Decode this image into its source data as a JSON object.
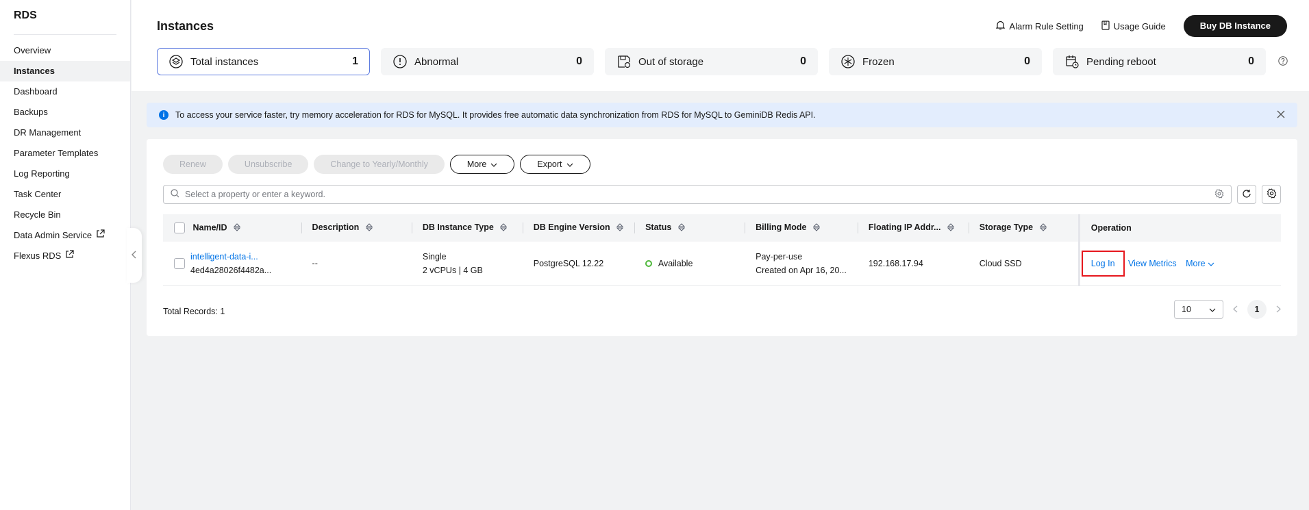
{
  "sidebar": {
    "title": "RDS",
    "items": [
      {
        "label": "Overview"
      },
      {
        "label": "Instances"
      },
      {
        "label": "Dashboard"
      },
      {
        "label": "Backups"
      },
      {
        "label": "DR Management"
      },
      {
        "label": "Parameter Templates"
      },
      {
        "label": "Log Reporting"
      },
      {
        "label": "Task Center"
      },
      {
        "label": "Recycle Bin"
      },
      {
        "label": "Data Admin Service"
      },
      {
        "label": "Flexus RDS"
      }
    ]
  },
  "header": {
    "title": "Instances",
    "alarm_label": "Alarm Rule Setting",
    "guide_label": "Usage Guide",
    "buy_label": "Buy DB Instance"
  },
  "stats": [
    {
      "label": "Total instances",
      "count": "1"
    },
    {
      "label": "Abnormal",
      "count": "0"
    },
    {
      "label": "Out of storage",
      "count": "0"
    },
    {
      "label": "Frozen",
      "count": "0"
    },
    {
      "label": "Pending reboot",
      "count": "0"
    }
  ],
  "notice": {
    "text": "To access your service faster, try memory acceleration for RDS for MySQL. It provides free automatic data synchronization from RDS for MySQL to GeminiDB Redis API."
  },
  "toolbar": {
    "renew": "Renew",
    "unsubscribe": "Unsubscribe",
    "change": "Change to Yearly/Monthly",
    "more": "More",
    "export": "Export"
  },
  "search": {
    "placeholder": "Select a property or enter a keyword."
  },
  "table": {
    "columns": [
      "Name/ID",
      "Description",
      "DB Instance Type",
      "DB Engine Version",
      "Status",
      "Billing Mode",
      "Floating IP Addr...",
      "Storage Type",
      "Operation"
    ],
    "rows": [
      {
        "name": "intelligent-data-i...",
        "id": "4ed4a28026f4482a...",
        "description": "--",
        "type_line1": "Single",
        "type_line2": "2 vCPUs | 4 GB",
        "engine": "PostgreSQL 12.22",
        "status": "Available",
        "billing_line1": "Pay-per-use",
        "billing_line2": "Created on Apr 16, 20...",
        "ip": "192.168.17.94",
        "storage": "Cloud SSD",
        "op_login": "Log In",
        "op_metrics": "View Metrics",
        "op_more": "More"
      }
    ]
  },
  "footer": {
    "total": "Total Records: 1",
    "page_size": "10",
    "current_page": "1"
  }
}
